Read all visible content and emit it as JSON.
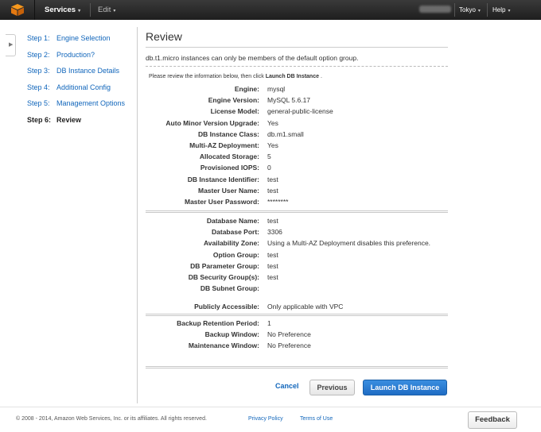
{
  "nav": {
    "services_label": "Services",
    "edit_label": "Edit",
    "region_label": "Tokyo",
    "help_label": "Help",
    "caret": "▾"
  },
  "steps": [
    {
      "num": "Step 1:",
      "label": "Engine Selection"
    },
    {
      "num": "Step 2:",
      "label": "Production?"
    },
    {
      "num": "Step 3:",
      "label": "DB Instance Details"
    },
    {
      "num": "Step 4:",
      "label": "Additional Config"
    },
    {
      "num": "Step 5:",
      "label": "Management Options"
    },
    {
      "num": "Step 6:",
      "label": "Review"
    }
  ],
  "review": {
    "title": "Review",
    "notice": "db.t1.micro instances can only be members of the default option group.",
    "instruction_prefix": "Please review the information below, then click",
    "instruction_bold": "Launch DB Instance",
    "instruction_suffix": "."
  },
  "section1": [
    {
      "label": "Engine:",
      "value": "mysql"
    },
    {
      "label": "Engine Version:",
      "value": "MySQL 5.6.17"
    },
    {
      "label": "License Model:",
      "value": "general-public-license"
    },
    {
      "label": "Auto Minor Version Upgrade:",
      "value": "Yes"
    },
    {
      "label": "DB Instance Class:",
      "value": "db.m1.small"
    },
    {
      "label": "Multi-AZ Deployment:",
      "value": "Yes"
    },
    {
      "label": "Allocated Storage:",
      "value": "5"
    },
    {
      "label": "Provisioned IOPS:",
      "value": "0"
    },
    {
      "label": "DB Instance Identifier:",
      "value": "test"
    },
    {
      "label": "Master User Name:",
      "value": "test"
    },
    {
      "label": "Master User Password:",
      "value": "********"
    }
  ],
  "section2": [
    {
      "label": "Database Name:",
      "value": "test"
    },
    {
      "label": "Database Port:",
      "value": "3306"
    },
    {
      "label": "Availability Zone:",
      "value": "Using a Multi-AZ Deployment disables this preference."
    },
    {
      "label": "Option Group:",
      "value": "test"
    },
    {
      "label": "DB Parameter Group:",
      "value": "test"
    },
    {
      "label": "DB Security Group(s):",
      "value": "test"
    },
    {
      "label": "DB Subnet Group:",
      "value": ""
    },
    {
      "label": "Publicly Accessible:",
      "value": "Only applicable with VPC"
    }
  ],
  "section3": [
    {
      "label": "Backup Retention Period:",
      "value": "1"
    },
    {
      "label": "Backup Window:",
      "value": "No Preference"
    },
    {
      "label": "Maintenance Window:",
      "value": "No Preference"
    }
  ],
  "buttons": {
    "cancel": "Cancel",
    "previous": "Previous",
    "launch": "Launch DB Instance"
  },
  "footer": {
    "copyright": "© 2008 - 2014, Amazon Web Services, Inc. or its affiliates. All rights reserved.",
    "privacy": "Privacy Policy",
    "terms": "Terms of Use",
    "feedback": "Feedback"
  },
  "colors": {
    "link": "#1166bb",
    "primary_button": "#1f6cc4",
    "topbar": "#232323",
    "logo": "#f7981d"
  }
}
